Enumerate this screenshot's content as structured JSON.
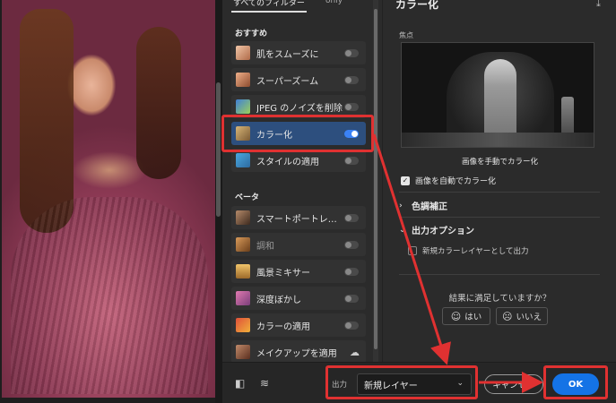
{
  "filter_list": {
    "tabs": [
      "すべてのフィルター",
      "only"
    ],
    "section_featured": "おすすめ",
    "section_beta": "ベータ",
    "featured_items": [
      {
        "label": "肌をスムーズに",
        "enabled": false
      },
      {
        "label": "スーパーズーム",
        "enabled": false
      },
      {
        "label": "JPEG のノイズを削除",
        "enabled": false
      },
      {
        "label": "カラー化",
        "enabled": true
      },
      {
        "label": "スタイルの適用",
        "enabled": false
      }
    ],
    "beta_items": [
      {
        "label": "スマートポートレ…",
        "enabled": false
      },
      {
        "label": "調和",
        "enabled": false
      },
      {
        "label": "風景ミキサー",
        "enabled": false
      },
      {
        "label": "深度ぼかし",
        "enabled": false
      },
      {
        "label": "カラーの適用",
        "enabled": false
      },
      {
        "label": "メイクアップを適用",
        "enabled": false
      }
    ]
  },
  "settings": {
    "title": "カラー化",
    "focus_label": "焦点",
    "manual_link": "画像を手動でカラー化",
    "auto_colorize_label": "画像を自動でカラー化",
    "auto_colorize_checked": true,
    "color_adjust_label": "色調補正",
    "output_options_label": "出力オプション",
    "new_color_layer_label": "新規カラーレイヤーとして出力",
    "new_color_layer_checked": false,
    "satisfied_question": "結果に満足していますか？",
    "yes_label": "はい",
    "no_label": "いいえ"
  },
  "bottom_bar": {
    "output_label": "出力",
    "output_value": "新規レイヤー",
    "cancel_label": "キャンセル",
    "ok_label": "OK"
  },
  "annotation": {
    "color": "#e03131"
  },
  "icons": [
    "panel-icon",
    "layers-icon",
    "dropdown-caret-icon",
    "cloud-download-icon",
    "smile-icon",
    "frown-icon",
    "check-icon",
    "chevron-right-icon",
    "chevron-down-icon"
  ]
}
